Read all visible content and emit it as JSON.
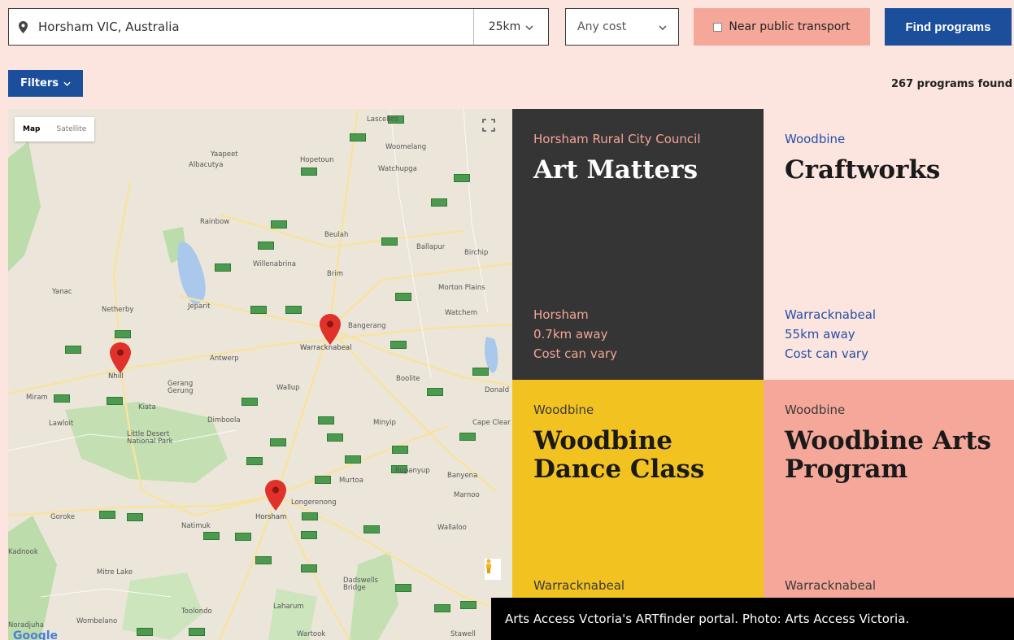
{
  "search": {
    "location_value": "Horsham VIC, Australia",
    "radius": "25km",
    "cost": "Any cost",
    "transport_label": "Near public transport",
    "find_button": "Find programs"
  },
  "filters_label": "Filters",
  "results_count": "267 programs found",
  "map": {
    "tab_map": "Map",
    "tab_satellite": "Satellite",
    "google_logo": "Google",
    "towns": [
      "Lascelles",
      "Woomelang",
      "Yaapeet",
      "Hopetoun",
      "Albacutya",
      "Watchupga",
      "Rainbow",
      "Beulah",
      "Ballapur",
      "Birchip",
      "Willenabrina",
      "Brim",
      "Morton Plains",
      "Yanac",
      "Netherby",
      "Jeparit",
      "Watchem",
      "Bangerang",
      "Warracknabeal",
      "Antwerp",
      "Nhill",
      "Gerang Gerung",
      "Wallup",
      "Boolite",
      "Donald",
      "Miram",
      "Kiata",
      "Lawloit",
      "Dimboola",
      "Minyip",
      "Cape Clear",
      "Little Desert National Park",
      "Rupanyup",
      "Banyena",
      "Murtoa",
      "Marnoo",
      "Longerenong",
      "Goroke",
      "Natimuk",
      "Horsham",
      "Wallaloo",
      "Kadnook",
      "Mitre Lake",
      "Dadswells Bridge",
      "Toolondo",
      "Laharum",
      "Wombelano",
      "Wartook",
      "Stawell",
      "Noradjuha"
    ]
  },
  "cards": [
    {
      "org": "Horsham Rural City Council",
      "title": "Art Matters",
      "location": "Horsham",
      "distance": "0.7km away",
      "cost": "Cost can vary"
    },
    {
      "org": "Woodbine",
      "title": "Craftworks",
      "location": "Warracknabeal",
      "distance": "55km away",
      "cost": "Cost can vary"
    },
    {
      "org": "Woodbine",
      "title": "Woodbine Dance Class",
      "location": "Warracknabeal",
      "distance": "",
      "cost": ""
    },
    {
      "org": "Woodbine",
      "title": "Woodbine Arts Program",
      "location": "Warracknabeal",
      "distance": "",
      "cost": ""
    }
  ],
  "caption": "Arts Access Vctoria's ARTfinder portal. Photo: Arts Access Victoria.",
  "colors": {
    "page_bg": "#fce4df",
    "brand_blue": "#1b4f9b",
    "salmon": "#f5a89a",
    "dark_card": "#353535",
    "yellow_card": "#f2c221"
  }
}
